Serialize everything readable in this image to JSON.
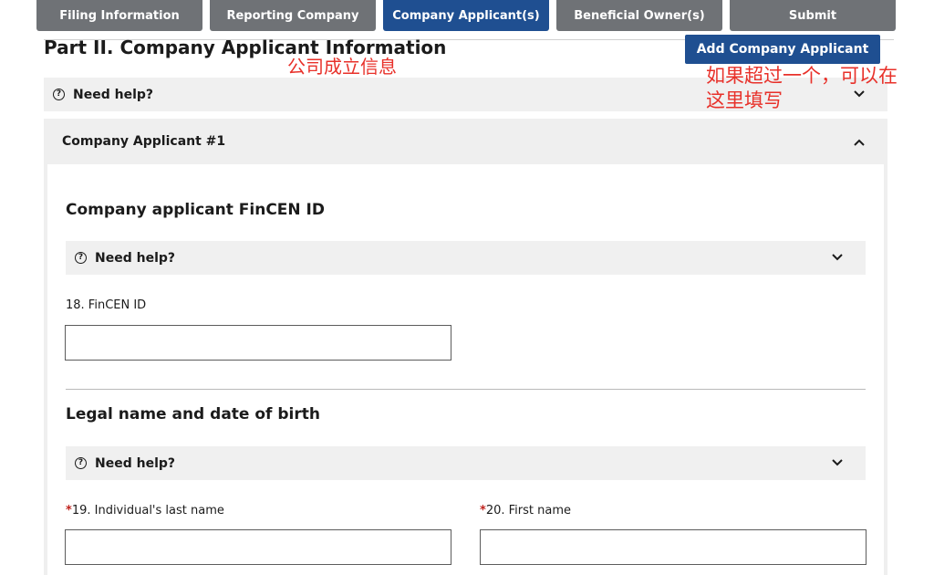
{
  "tabs": [
    {
      "label": "Filing Information",
      "active": false
    },
    {
      "label": "Reporting Company",
      "active": false
    },
    {
      "label": "Company Applicant(s)",
      "active": true
    },
    {
      "label": "Beneficial Owner(s)",
      "active": false
    },
    {
      "label": "Submit",
      "active": false
    }
  ],
  "header": {
    "title": "Part II. Company Applicant Information",
    "add_button": "Add Company Applicant"
  },
  "annotations": {
    "title_note": "公司成立信息",
    "button_note_line1": "如果超过一个，可以在",
    "button_note_line2": "这里填写"
  },
  "help": {
    "label": "Need help?",
    "icon": "question-circle-icon"
  },
  "applicant_card": {
    "title": "Company Applicant #1",
    "fincen_section": {
      "heading": "Company applicant FinCEN ID",
      "field_label": "18. FinCEN ID",
      "field_value": ""
    },
    "legal_section": {
      "heading": "Legal name and date of birth",
      "last_name_required": "*",
      "last_name_label": "19. Individual's last name",
      "last_name_value": "",
      "first_name_required": "*",
      "first_name_label": "20. First name",
      "first_name_value": ""
    }
  },
  "colors": {
    "tab_inactive": "#6f7276",
    "tab_active": "#1f4f91",
    "primary_button": "#1f4f91",
    "annotation": "#e8312a",
    "required": "#c0231e",
    "panel": "#f0f0f0"
  }
}
